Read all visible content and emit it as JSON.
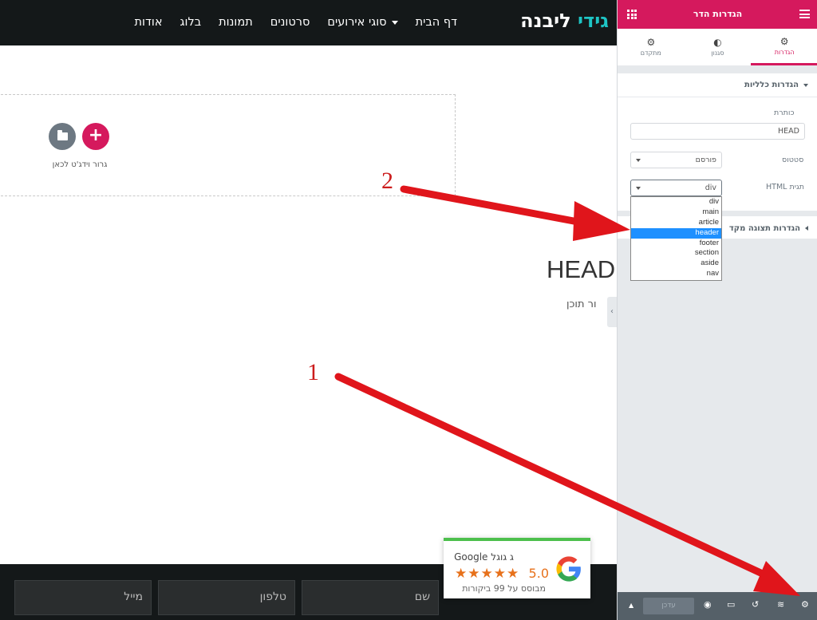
{
  "site": {
    "logo": {
      "part1": "גידי",
      "part2": "ליבנה"
    },
    "nav": [
      "דף הבית",
      "סוגי אירועים",
      "סרטונים",
      "תמונות",
      "בלוג",
      "אודות"
    ],
    "drop_zone_text": "גרור וידג'ט לכאן",
    "heading": "HEAD",
    "subtext": "ור תוכן",
    "form_fields": {
      "name": "שם",
      "phone": "טלפון",
      "mail": "מייל"
    }
  },
  "google_card": {
    "title": "Google ג גוגל",
    "score": "5.0",
    "stars": "★★★★★",
    "based_on": "מבוסס על 99 ביקורות"
  },
  "panel": {
    "title": "הגדרות הדר",
    "tabs": [
      {
        "label": "הגדרות",
        "icon": "gear-icon",
        "glyph": "⚙"
      },
      {
        "label": "סגנון",
        "icon": "contrast-icon",
        "glyph": "◐"
      },
      {
        "label": "מתקדם",
        "icon": "gear-icon",
        "glyph": "⚙"
      }
    ],
    "general_section": "הגדרות כלליות",
    "title_label": "כותרת",
    "title_value": "HEAD",
    "status_label": "סטטוס",
    "status_value": "פורסם",
    "html_tag_label": "תגית HTML",
    "html_tag_value": "div",
    "html_tag_options": [
      "div",
      "main",
      "article",
      "header",
      "footer",
      "section",
      "aside",
      "nav"
    ],
    "html_tag_highlighted": "header",
    "advanced_section": "הגדרות תצוגה מקד",
    "footer_publish": "עדכן"
  },
  "annotations": {
    "arrow1_label": "1",
    "arrow2_label": "2"
  },
  "colors": {
    "accent": "#d5195d",
    "panel_bg": "#e6e9ec",
    "header_dark": "#141819",
    "arrow": "#e0151b",
    "select_highlight": "#1e90ff"
  }
}
